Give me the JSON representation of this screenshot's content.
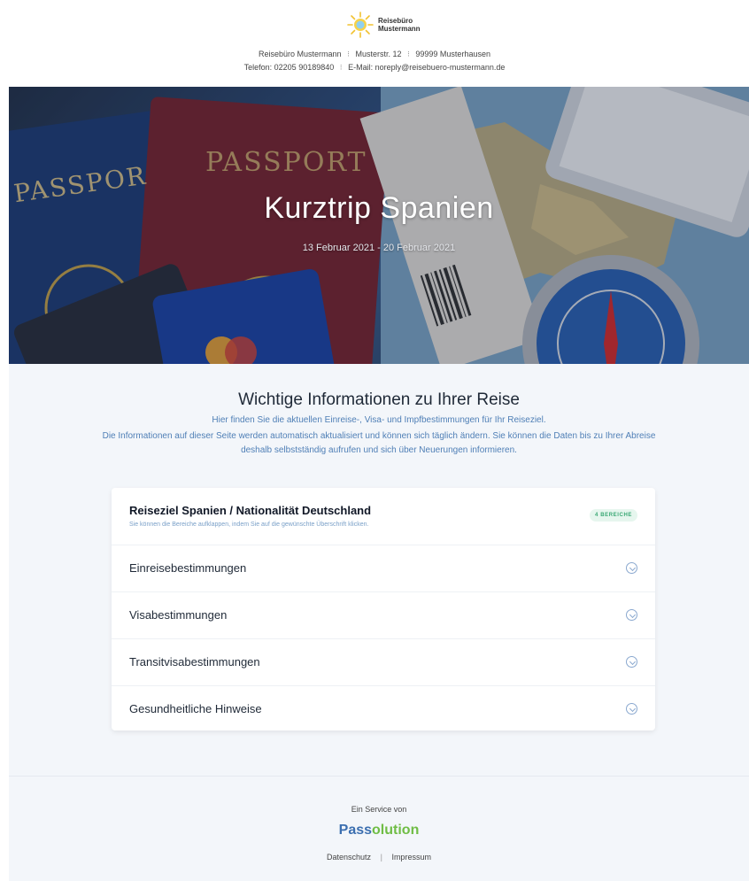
{
  "header": {
    "logo": {
      "line1": "Reisebüro",
      "line2": "Mustermann"
    },
    "contact": {
      "company": "Reisebüro Mustermann",
      "street": "Musterstr. 12",
      "city": "99999 Musterhausen",
      "phone": "Telefon: 02205 90189840",
      "email": "E-Mail: noreply@reisebuero-mustermann.de"
    }
  },
  "hero": {
    "title": "Kurztrip Spanien",
    "dates": "13 Februar 2021 - 20 Februar 2021",
    "passport_text_1": "PASSPORT",
    "passport_text_2": "PASSPOR"
  },
  "info": {
    "title": "Wichtige Informationen zu Ihrer Reise",
    "subtitle": "Hier finden Sie die aktuellen Einreise-, Visa- und Impfbestimmungen für Ihr Reiseziel.",
    "text": "Die Informationen auf dieser Seite werden automatisch aktualisiert und können sich täglich ändern. Sie können die Daten bis zu Ihrer Abreise deshalb selbstständig aufrufen und sich über Neuerungen informieren."
  },
  "card": {
    "title": "Reiseziel Spanien / Nationalität Deutschland",
    "hint": "Sie können die Bereiche aufklappen, indem Sie auf die gewünschte Überschrift klicken.",
    "badge": "4 BEREICHE",
    "sections": [
      {
        "label": "Einreisebestimmungen"
      },
      {
        "label": "Visabestimmungen"
      },
      {
        "label": "Transitvisabestimmungen"
      },
      {
        "label": "Gesundheitliche Hinweise"
      }
    ]
  },
  "footer": {
    "service": "Ein Service von",
    "brand_part1": "Pass",
    "brand_part2": "olution",
    "links": {
      "privacy": "Datenschutz",
      "imprint": "Impressum"
    }
  },
  "colors": {
    "accent_blue": "#3c6fb0",
    "accent_green": "#6fbd45",
    "badge_green": "#3aa874",
    "info_text": "#4f7fb6"
  }
}
